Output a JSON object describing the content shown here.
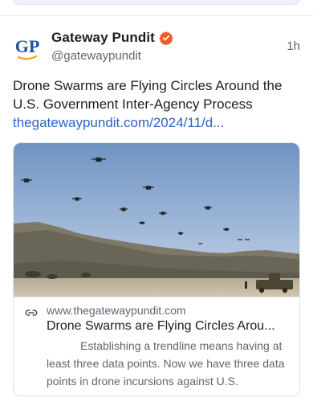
{
  "post": {
    "author": {
      "display_name": "Gateway Pundit",
      "handle": "@gatewaypundit",
      "avatar_initials": "GP",
      "verified": true
    },
    "timestamp": "1h",
    "text": "Drone Swarms are Flying Circles Around the U.S. Government Inter-Agency Process",
    "link_text": "thegatewaypundit.com/2024/11/d..."
  },
  "link_card": {
    "domain": "www.thegatewaypundit.com",
    "title": "Drone Swarms are Flying Circles Arou...",
    "description": "Establishing a trendline means having at least three data points.  Now we have three data points in drone incursions against U.S."
  },
  "colors": {
    "link": "#2b63c7",
    "verified_badge": "#f05a28",
    "avatar_blue": "#1f4f9d",
    "avatar_orange": "#f5a623"
  },
  "icons": {
    "verified": "verified-badge-icon",
    "link": "link-icon"
  }
}
